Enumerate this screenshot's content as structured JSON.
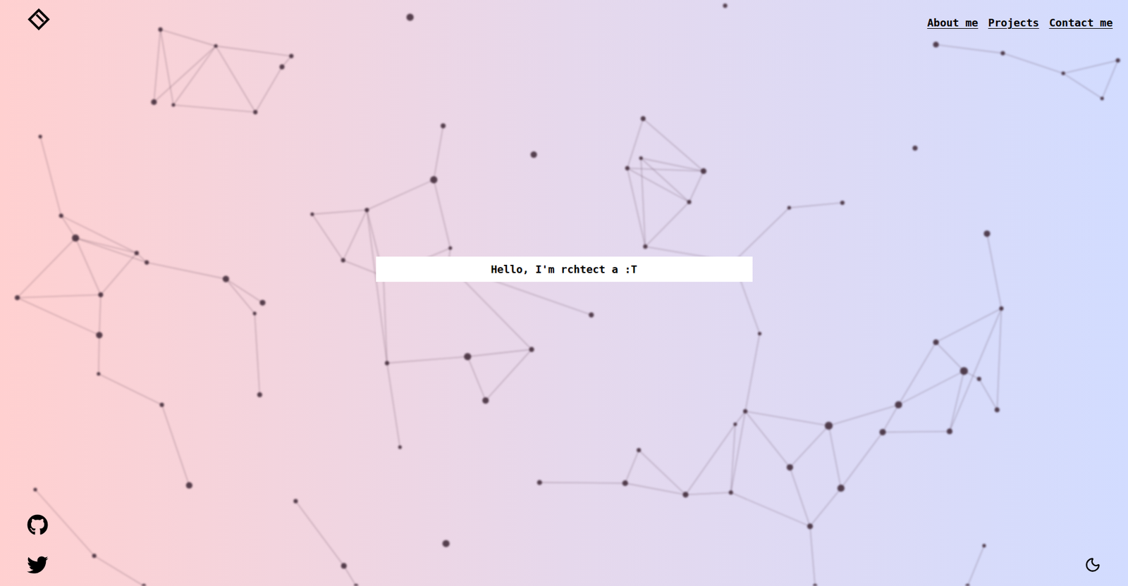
{
  "nav": [
    {
      "label": "About me"
    },
    {
      "label": "Projects"
    },
    {
      "label": "Contact me"
    }
  ],
  "hero": {
    "text": "Hello, I'm rchtect a :T"
  },
  "social": [
    {
      "kind": "github"
    },
    {
      "kind": "twitter"
    }
  ],
  "theme": {
    "dark": false
  }
}
